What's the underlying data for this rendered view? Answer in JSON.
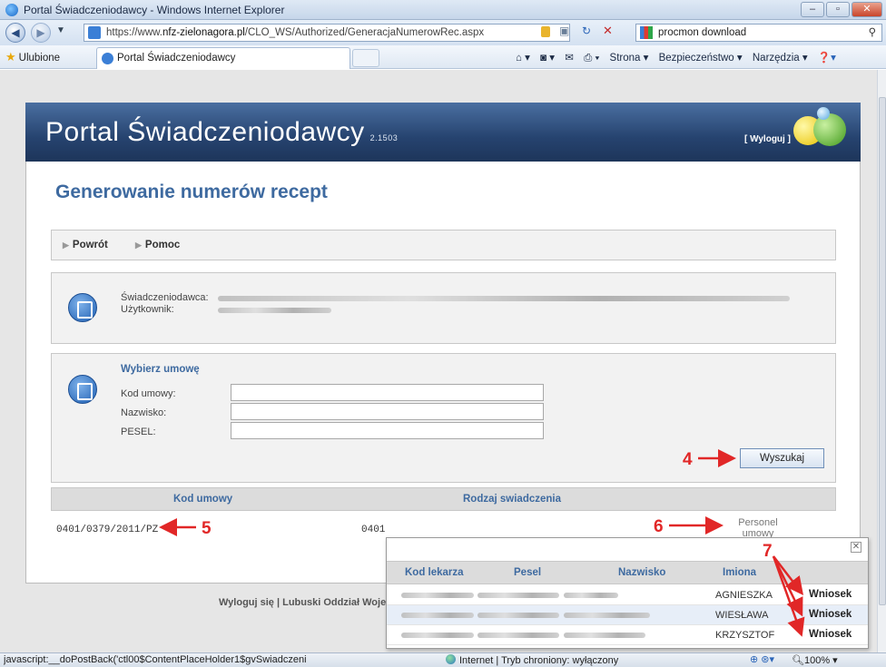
{
  "window": {
    "title": "Portal Świadczeniodawcy - Windows Internet Explorer",
    "min": "–",
    "max": "▫",
    "close": "✕"
  },
  "address": {
    "prefix": "https://www.",
    "host": "nfz-zielonagora.pl",
    "path": "/CLO_WS/Authorized/GeneracjaNumerowRec.aspx",
    "search_text": "procmon download"
  },
  "favbar": {
    "favorites": "Ulubione",
    "tab_title": "Portal Świadczeniodawcy",
    "menu_strona": "Strona ▾",
    "menu_bezp": "Bezpieczeństwo ▾",
    "menu_narz": "Narzędzia ▾"
  },
  "banner": {
    "title": "Portal Świadczeniodawcy",
    "version": "2.1503",
    "logout": "[ Wyloguj ]"
  },
  "page": {
    "heading": "Generowanie numerów recept"
  },
  "nav": {
    "back": "Powrót",
    "help": "Pomoc"
  },
  "info": {
    "provider_label": "Świadczeniodawca:",
    "user_label": "Użytkownik:"
  },
  "form": {
    "title": "Wybierz umowę",
    "code_label": "Kod umowy:",
    "surname_label": "Nazwisko:",
    "pesel_label": "PESEL:",
    "code_value": "",
    "surname_value": "",
    "pesel_value": "",
    "search_button": "Wyszukaj"
  },
  "table": {
    "col1": "Kod umowy",
    "col2": "Rodzaj swiadczenia",
    "row_code": "0401/0379/2011/PZ",
    "row_type": "0401",
    "row_staff": "Personel umowy"
  },
  "footer": {
    "text": "Wyloguj się | Lubuski Oddział Woje"
  },
  "popup": {
    "close": "✕",
    "col_kod": "Kod lekarza",
    "col_pesel": "Pesel",
    "col_nazwisko": "Nazwisko",
    "col_imiona": "Imiona",
    "rows": [
      {
        "name": "AGNIESZKA",
        "action": "Wniosek"
      },
      {
        "name": "WIESŁAWA",
        "action": "Wniosek"
      },
      {
        "name": "KRZYSZTOF",
        "action": "Wniosek"
      }
    ]
  },
  "annotations": {
    "a4": "4",
    "a5": "5",
    "a6": "6",
    "a7": "7"
  },
  "status": {
    "left": "javascript:__doPostBack('ctl00$ContentPlaceHolder1$gvSwiadczeni",
    "zone": "Internet | Tryb chroniony: wyłączony",
    "zoom": "100%"
  }
}
